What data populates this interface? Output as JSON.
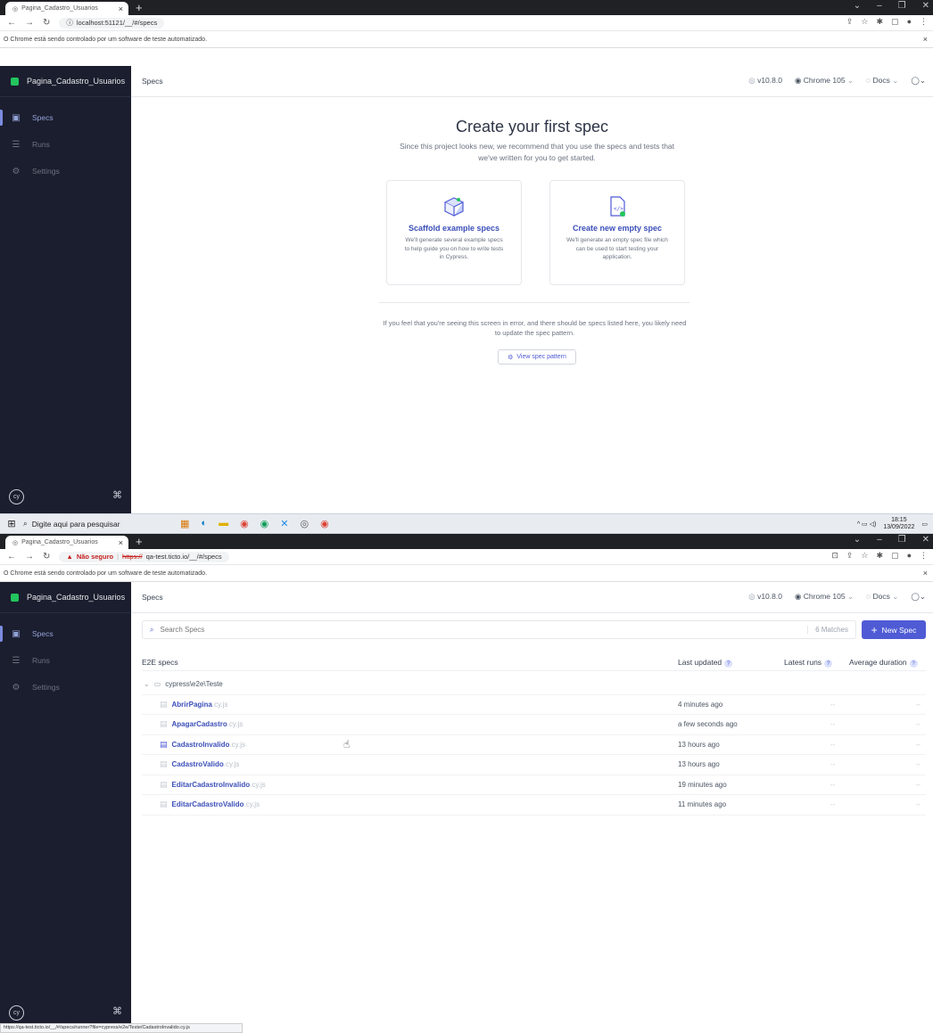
{
  "top": {
    "tab_title": "Pagina_Cadastro_Usuarios",
    "url": "localhost:51121/__/#/specs",
    "automation_banner": "O Chrome está sendo controlado por um software de teste automatizado.",
    "project_name": "Pagina_Cadastro_Usuarios",
    "sidebar": [
      {
        "label": "Specs",
        "icon": "specs-icon"
      },
      {
        "label": "Runs",
        "icon": "runs-icon"
      },
      {
        "label": "Settings",
        "icon": "settings-icon"
      }
    ],
    "header_title": "Specs",
    "version": "v10.8.0",
    "browser": "Chrome 105",
    "docs": "Docs",
    "empty_title": "Create your first spec",
    "empty_subtitle": "Since this project looks new, we recommend that you use the specs and tests that we've written for you to get started.",
    "card_scaffold": {
      "title": "Scaffold example specs",
      "desc": "We'll generate several example specs to help guide you on how to write tests in Cypress."
    },
    "card_empty": {
      "title": "Create new empty spec",
      "desc": "We'll generate an empty spec file which can be used to start testing your application."
    },
    "error_text": "If you feel that you're seeing this screen in error, and there should be specs listed here, you likely need to update the spec pattern.",
    "view_spec_pattern": "View spec pattern"
  },
  "taskbar": {
    "search_placeholder": "Digite aqui para pesquisar",
    "time": "18:15",
    "date": "13/09/2022"
  },
  "bottom": {
    "tab_title": "Pagina_Cadastro_Usuarios",
    "not_secure": "Não seguro",
    "url_scheme": "https://",
    "url_rest": "qa-test.ticto.io/__/#/specs",
    "automation_banner": "O Chrome está sendo controlado por um software de teste automatizado.",
    "project_name": "Pagina_Cadastro_Usuarios",
    "sidebar": [
      {
        "label": "Specs",
        "icon": "specs-icon"
      },
      {
        "label": "Runs",
        "icon": "runs-icon"
      },
      {
        "label": "Settings",
        "icon": "settings-icon"
      }
    ],
    "header_title": "Specs",
    "version": "v10.8.0",
    "browser": "Chrome 105",
    "docs": "Docs",
    "search_placeholder": "Search Specs",
    "matches": "6 Matches",
    "new_spec": "New Spec",
    "col_specs": "E2E specs",
    "col_last_updated": "Last updated",
    "col_latest_runs": "Latest runs",
    "col_avg_duration": "Average duration",
    "folder": "cypress\\e2e\\Teste",
    "specs": [
      {
        "name": "AbrirPagina",
        "ext": ".cy.js",
        "updated": "4 minutes ago",
        "runs": "--",
        "duration": "--"
      },
      {
        "name": "ApagarCadastro",
        "ext": ".cy.js",
        "updated": "a few seconds ago",
        "runs": "--",
        "duration": "--"
      },
      {
        "name": "CadastroInvalido",
        "ext": ".cy.js",
        "updated": "13 hours ago",
        "runs": "--",
        "duration": "--"
      },
      {
        "name": "CadastroValido",
        "ext": ".cy.js",
        "updated": "13 hours ago",
        "runs": "--",
        "duration": "--"
      },
      {
        "name": "EditarCadastroInvalido",
        "ext": ".cy.js",
        "updated": "19 minutes ago",
        "runs": "--",
        "duration": "--"
      },
      {
        "name": "EditarCadastroValido",
        "ext": ".cy.js",
        "updated": "11 minutes ago",
        "runs": "--",
        "duration": "--"
      }
    ],
    "status_url": "https://qa-test.ticto.io/__/#/specs/runner?file=cypress/e2e/Teste/CadastroInvalido.cy.js"
  }
}
